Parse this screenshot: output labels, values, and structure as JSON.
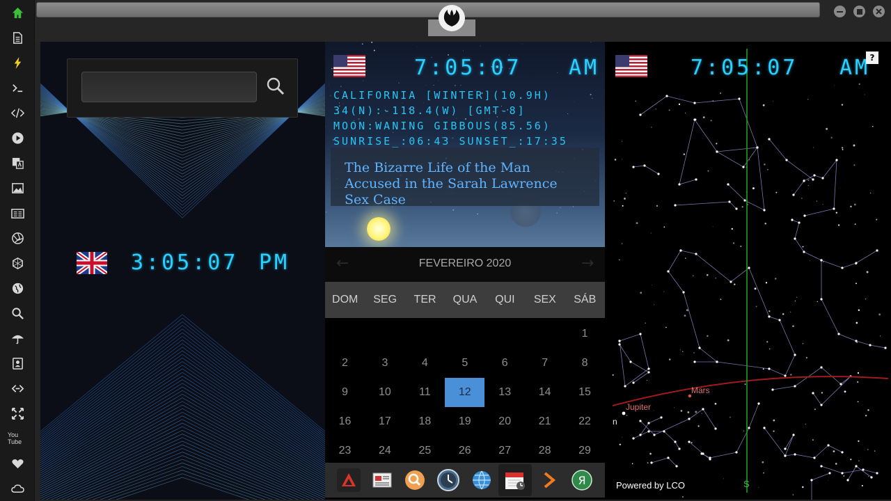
{
  "sidebar": {
    "items": [
      "home-icon",
      "document-icon",
      "bolt-icon",
      "terminal-icon",
      "code-icon",
      "play-icon",
      "translate-icon",
      "image-icon",
      "newspaper-icon",
      "aperture-icon",
      "hexagon-icon",
      "globe-icon",
      "search-icon",
      "umbrella-icon",
      "contacts-icon",
      "link-icon",
      "expand-icon",
      "youtube-icon",
      "heart-icon",
      "cloud-icon"
    ],
    "youtube_label": "You Tube"
  },
  "colors": {
    "digital_blue": "#2ad0ff",
    "today_highlight": "#4a90d9",
    "home_icon_green": "#3cc03c",
    "bolt_yellow": "#f0d030",
    "ecliptic_red": "#a01c1c",
    "meridian_green": "#1e9e1e"
  },
  "left_clock": {
    "search_placeholder": "",
    "time": "3:05:07",
    "ampm": "PM"
  },
  "middle_clock": {
    "time": "7:05:07",
    "ampm": "AM",
    "info": [
      "CALIFORNIA [WINTER](10.9H)",
      "34(N):-118.4(W) [GMT-8]",
      "MOON:WANING GIBBOUS(85.56)",
      "SUNRISE_:06:43 SUNSET_:17:35"
    ],
    "headline": "The Bizarre Life of the Man Accused in the Sarah Lawrence Sex Case"
  },
  "calendar": {
    "month": "FEVEREIRO 2020",
    "prev": "←",
    "next": "→",
    "daynames": [
      "DOM",
      "SEG",
      "TER",
      "QUA",
      "QUI",
      "SEX",
      "SÁB"
    ],
    "weeks": [
      [
        "",
        "",
        "",
        "",
        "",
        "",
        "1"
      ],
      [
        "2",
        "3",
        "4",
        "5",
        "6",
        "7",
        "8"
      ],
      [
        "9",
        "10",
        "11",
        "12",
        "13",
        "14",
        "15"
      ],
      [
        "16",
        "17",
        "18",
        "19",
        "20",
        "21",
        "22"
      ],
      [
        "23",
        "24",
        "25",
        "26",
        "27",
        "28",
        "29"
      ]
    ],
    "today": "12"
  },
  "dock": [
    "mountain-app-icon",
    "news-app-icon",
    "search-app-icon",
    "clock-app-icon",
    "globe-app-icon",
    "calendar-app-icon",
    "arrow-app-icon",
    "yandex-app-icon"
  ],
  "right_clock": {
    "time": "7:05:07",
    "ampm": "AM",
    "help": "?",
    "planets": [
      "Jupiter",
      "Mars"
    ],
    "edge_label": "n",
    "south_label": "S",
    "powered_by": "Powered by  LCO"
  }
}
